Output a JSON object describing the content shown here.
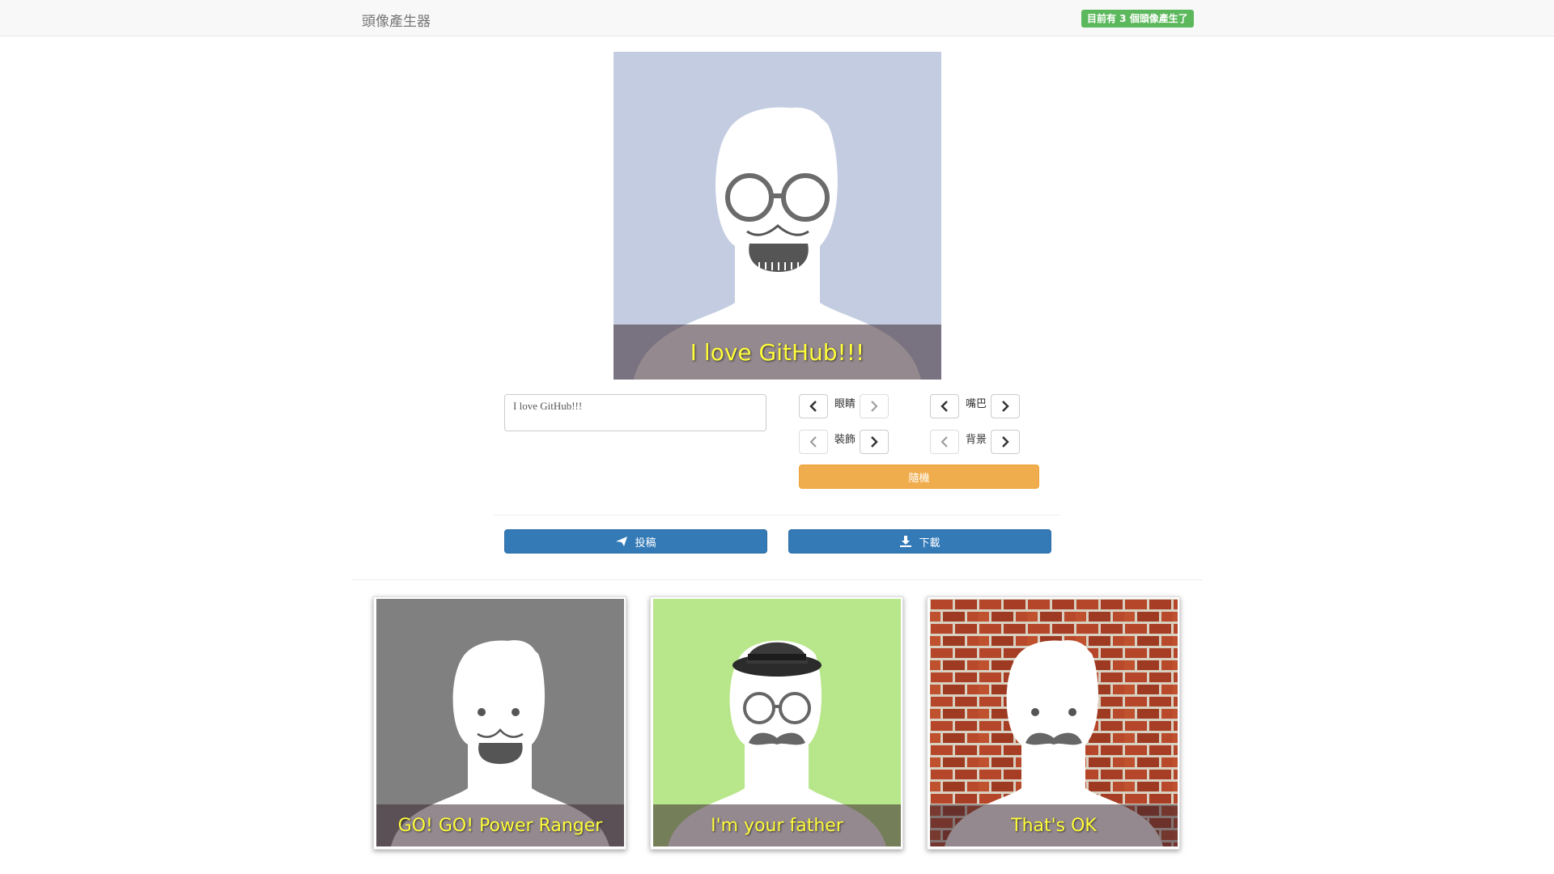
{
  "navbar": {
    "brand": "頭像產生器",
    "counter_badge": "目前有 3 個頭像產生了"
  },
  "preview": {
    "caption": "I love GitHub!!!",
    "background_color": "#c3cce0",
    "eyes": "round-glasses-icon",
    "mouth": "grin-with-mustache-icon"
  },
  "editor": {
    "message_value": "I love GitHub!!!",
    "controls": {
      "eyes_label": "眼睛",
      "mouth_label": "嘴巴",
      "accessory_label": "裝飾",
      "background_label": "背景"
    },
    "random_label": "隨機",
    "submit_label": "投稿",
    "download_label": "下載"
  },
  "gallery": [
    {
      "caption": "GO! GO! Power Ranger",
      "background_color": "#808080"
    },
    {
      "caption": "I'm your father",
      "background_color": "#b8e68a"
    },
    {
      "caption": "That's OK",
      "background_color": "#b5462a"
    }
  ],
  "colors": {
    "badge": "#5cb85c",
    "primary": "#337ab7",
    "warning": "#f0ad4e",
    "caption_text": "#fffc3a"
  }
}
